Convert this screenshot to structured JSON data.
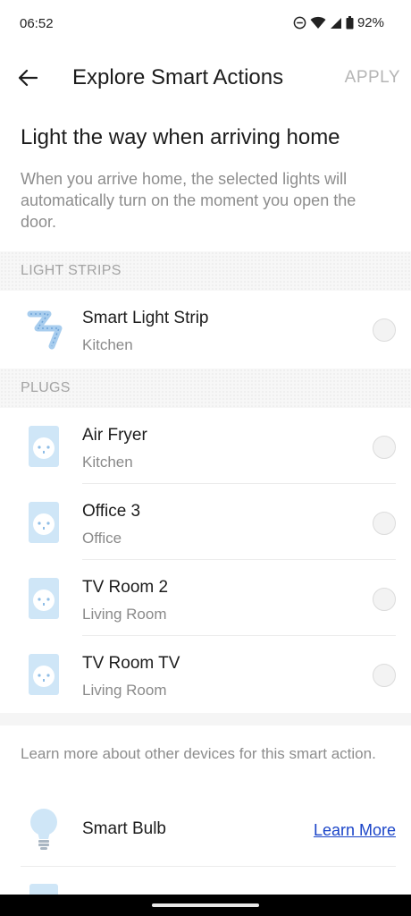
{
  "status": {
    "time": "06:52",
    "battery": "92%",
    "icons": [
      "do-not-disturb-icon",
      "wifi-icon",
      "signal-icon",
      "battery-icon"
    ]
  },
  "app_bar": {
    "title": "Explore Smart Actions",
    "apply_label": "APPLY"
  },
  "headline": "Light the way when arriving home",
  "description": "When you arrive home, the selected lights will automatically turn on the moment you open the door.",
  "sections": {
    "light_strips": {
      "header": "LIGHT STRIPS",
      "items": [
        {
          "name": "Smart Light Strip",
          "room": "Kitchen",
          "selected": false
        }
      ]
    },
    "plugs": {
      "header": "PLUGS",
      "items": [
        {
          "name": "Air Fryer",
          "room": "Kitchen",
          "selected": false
        },
        {
          "name": "Office 3",
          "room": "Office",
          "selected": false
        },
        {
          "name": "TV Room 2",
          "room": "Living Room",
          "selected": false
        },
        {
          "name": "TV Room TV",
          "room": "Living Room",
          "selected": false
        }
      ]
    }
  },
  "learn_more": {
    "intro": "Learn more about other devices for this smart action.",
    "items": [
      {
        "name": "Smart Bulb",
        "link_label": "Learn More"
      }
    ]
  },
  "colors": {
    "accent_link": "#1a44c8",
    "device_icon_fill": "#cfe6f7",
    "disabled_text": "#b5b5b5"
  }
}
